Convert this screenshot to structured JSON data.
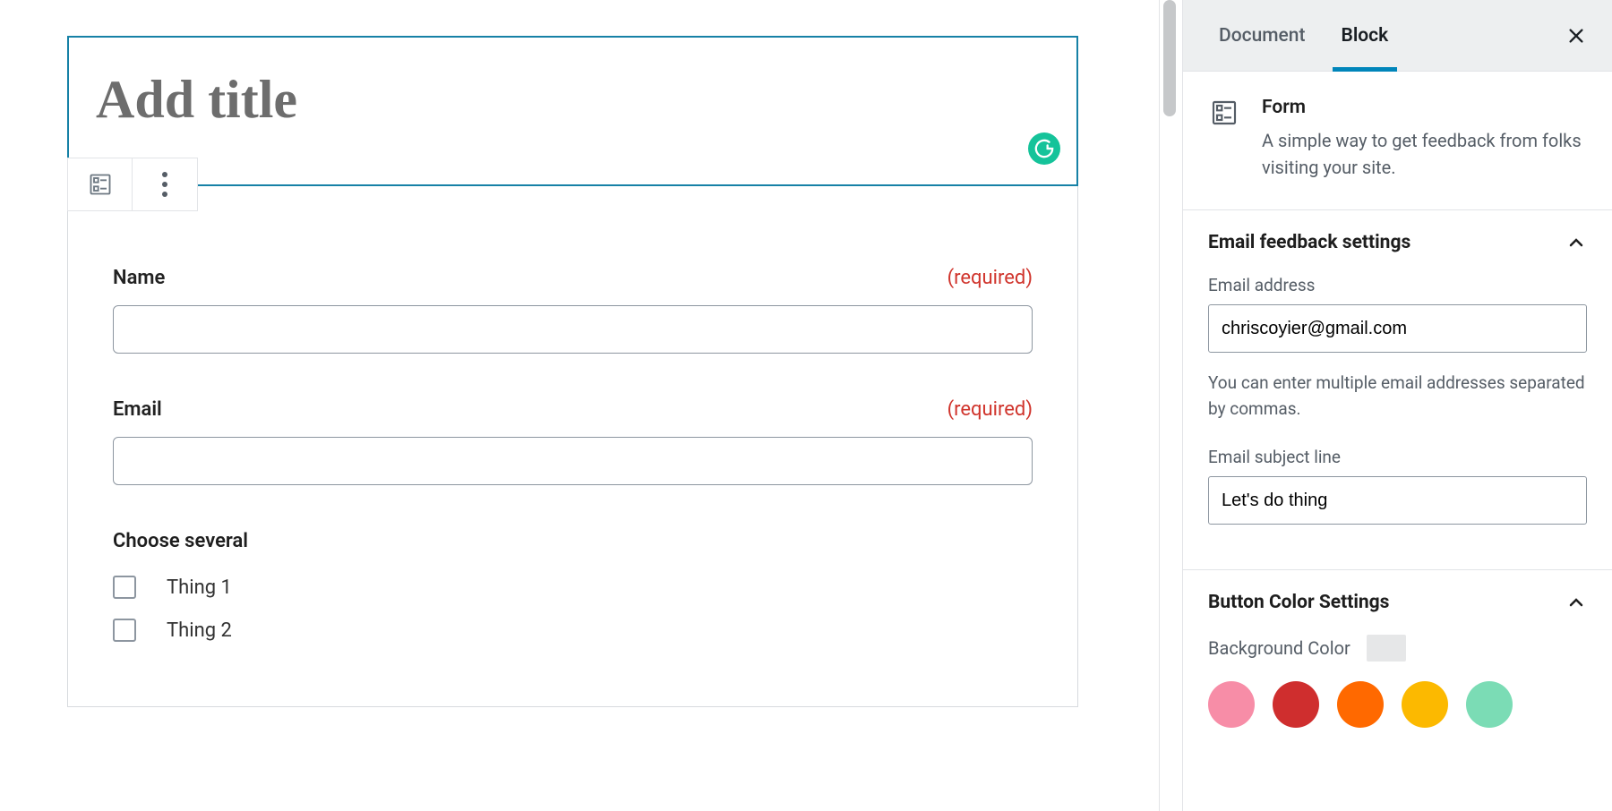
{
  "editor": {
    "title_placeholder": "Add title",
    "form_block": {
      "fields": [
        {
          "label": "Name",
          "required_text": "(required)"
        },
        {
          "label": "Email",
          "required_text": "(required)"
        }
      ],
      "choices": {
        "label": "Choose several",
        "options": [
          "Thing 1",
          "Thing 2"
        ]
      }
    }
  },
  "sidebar": {
    "tabs": {
      "document": "Document",
      "block": "Block"
    },
    "block_info": {
      "title": "Form",
      "description": "A simple way to get feedback from folks visiting your site."
    },
    "panels": {
      "email": {
        "title": "Email feedback settings",
        "email_label": "Email address",
        "email_value": "chriscoyier@gmail.com",
        "email_help": "You can enter multiple email addresses separated by commas.",
        "subject_label": "Email subject line",
        "subject_value": "Let's do thing"
      },
      "button_color": {
        "title": "Button Color Settings",
        "bg_label": "Background Color",
        "swatches": [
          "#f78da7",
          "#cf2e2e",
          "#ff6900",
          "#fcb900",
          "#7bdcb5"
        ]
      }
    }
  }
}
